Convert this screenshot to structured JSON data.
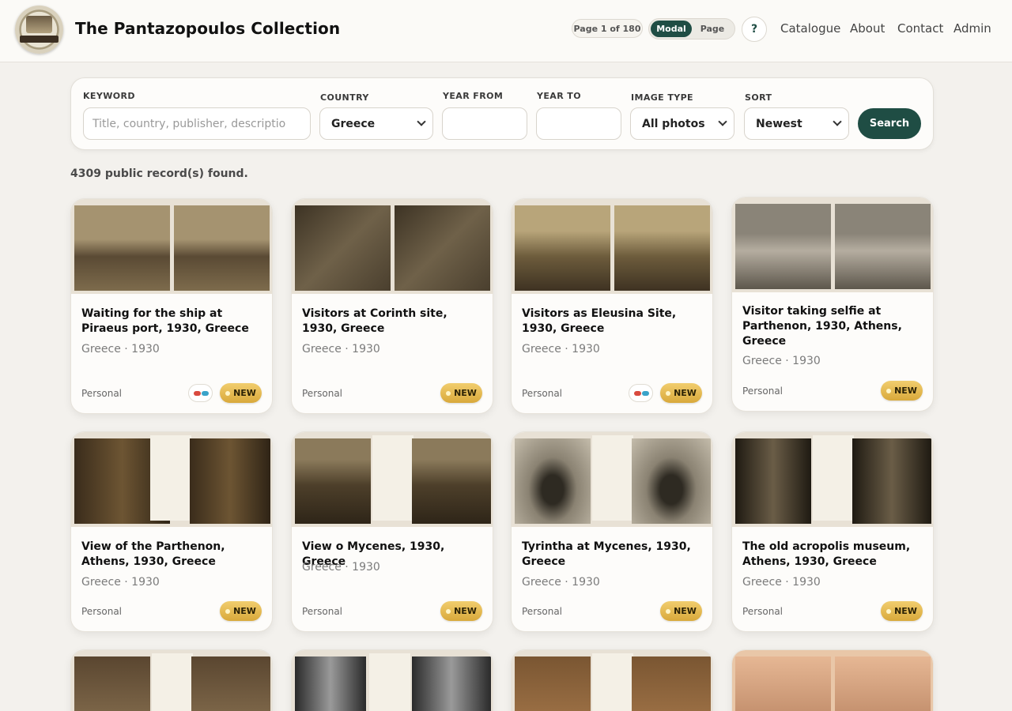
{
  "header": {
    "title": "The Pantazopoulos Collection",
    "page_indicator": "Page 1 of 180",
    "view_modes": [
      "Modal",
      "Page"
    ],
    "help_label": "?",
    "nav": [
      "Catalogue",
      "About",
      "Contact",
      "Admin"
    ]
  },
  "search": {
    "keyword_label": "KEYWORD",
    "keyword_placeholder": "Title, country, publisher, descriptio",
    "country_label": "COUNTRY",
    "country_value": "Greece",
    "year_from_label": "YEAR FROM",
    "year_to_label": "YEAR TO",
    "image_type_label": "IMAGE TYPE",
    "image_type_value": "All photos",
    "sort_label": "SORT",
    "sort_value": "Newest",
    "search_button": "Search"
  },
  "results": {
    "count_text": "4309 public record(s) found."
  },
  "cards": [
    {
      "title": "Waiting for the ship at Piraeus port, 1930, Greece",
      "meta": "Greece · 1930",
      "owner": "Personal",
      "badge": "NEW",
      "stereo": true
    },
    {
      "title": "Visitors at Corinth site, 1930, Greece",
      "meta": "Greece · 1930",
      "owner": "Personal",
      "badge": "NEW",
      "stereo": false
    },
    {
      "title": "Visitors as Eleusina Site, 1930, Greece",
      "meta": "Greece · 1930",
      "owner": "Personal",
      "badge": "NEW",
      "stereo": true
    },
    {
      "title": "Visitor taking selfie at Parthenon, 1930, Athens, Greece",
      "meta": "Greece · 1930",
      "owner": "Personal",
      "badge": "NEW",
      "stereo": false
    },
    {
      "title": "View of the Parthenon, Athens, 1930, Greece",
      "meta": "Greece · 1930",
      "owner": "Personal",
      "badge": "NEW",
      "stereo": false
    },
    {
      "title": "View o Mycenes, 1930, Greece",
      "meta": "Greece · 1930",
      "owner": "Personal",
      "badge": "NEW",
      "stereo": false
    },
    {
      "title": "Tyrintha at Mycenes, 1930, Greece",
      "meta": "Greece · 1930",
      "owner": "Personal",
      "badge": "NEW",
      "stereo": false
    },
    {
      "title": "The old acropolis museum, Athens, 1930, Greece",
      "meta": "Greece · 1930",
      "owner": "Personal",
      "badge": "NEW",
      "stereo": false
    }
  ],
  "colors": {
    "accent": "#1f4d44",
    "badge": "#e3b54e",
    "background": "#f3f1ed"
  },
  "icons": [
    "logo-seal",
    "help-icon",
    "stereo-glasses-icon",
    "chevron-down-icon"
  ]
}
